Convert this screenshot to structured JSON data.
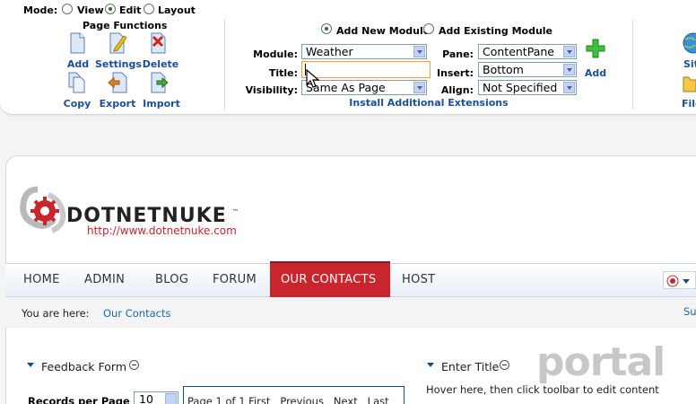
{
  "control_panel": {
    "mode_label": "Mode:",
    "modes": [
      "View",
      "Edit",
      "Layout"
    ],
    "selected_mode": "Edit",
    "page_functions": {
      "title": "Page Functions",
      "buttons": [
        "Add",
        "Settings",
        "Delete",
        "Copy",
        "Export",
        "Import"
      ]
    },
    "module_options": [
      "Add New Module",
      "Add Existing Module"
    ],
    "selected_module_option": "Add New Module",
    "module_label": "Module:",
    "module_value": "Weather",
    "title_label": "Title:",
    "title_value": "",
    "visibility_label": "Visibility:",
    "visibility_value": "Same As Page",
    "pane_label": "Pane:",
    "pane_value": "ContentPane",
    "insert_label": "Insert:",
    "insert_value": "Bottom",
    "align_label": "Align:",
    "align_value": "Not Specified",
    "add_label": "Add",
    "install_link": "Install Additional Extensions",
    "right_labels": [
      "Sit",
      "File"
    ]
  },
  "site": {
    "logo_text": "DOTNETNUKE",
    "logo_tm": "™",
    "logo_url": "http://www.dotnetnuke.com",
    "nav": [
      "HOME",
      "ADMIN",
      "BLOG",
      "FORUM",
      "OUR CONTACTS",
      "HOST"
    ],
    "active_nav": "OUR CONTACTS",
    "breadcrumb_label": "You are here:",
    "breadcrumb_current": "Our Contacts",
    "breadcrumb_right": "Su"
  },
  "modules": {
    "feedback_title": "Feedback Form",
    "records_label": "Records per Page",
    "records_value": "10",
    "pager_text": "Page 1 of 1 First   Previous   Next   Last",
    "enter_title": "Enter Title",
    "hover_hint": "Hover here, then click toolbar to edit content"
  },
  "watermark": "portal",
  "colors": {
    "brand_red": "#c8252c",
    "link_blue": "#1a4f9a",
    "add_green": "#2ea32e"
  }
}
